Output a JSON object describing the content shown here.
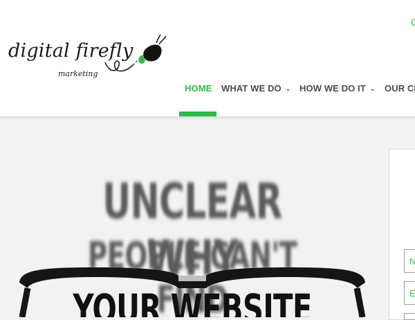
{
  "header": {
    "top_link": "C",
    "logo": {
      "wordmark": "digital firefly",
      "tagline": "marketing"
    },
    "nav": [
      {
        "label": "HOME",
        "active": true,
        "has_dropdown": false
      },
      {
        "label": "WHAT WE DO",
        "active": false,
        "has_dropdown": true
      },
      {
        "label": "HOW WE DO IT",
        "active": false,
        "has_dropdown": true
      },
      {
        "label": "OUR CL",
        "active": false,
        "has_dropdown": false
      }
    ],
    "chevron_glyph": "⌄",
    "colors": {
      "accent": "#2eb84b",
      "nav_text": "#4a4a4a"
    }
  },
  "hero": {
    "lines": [
      "UNCLEAR WHY",
      "PEOPLE CAN'T FIND",
      "YOUR WEBSITE"
    ]
  },
  "form": {
    "fields": [
      {
        "placeholder": "N"
      },
      {
        "placeholder": "E"
      }
    ]
  }
}
